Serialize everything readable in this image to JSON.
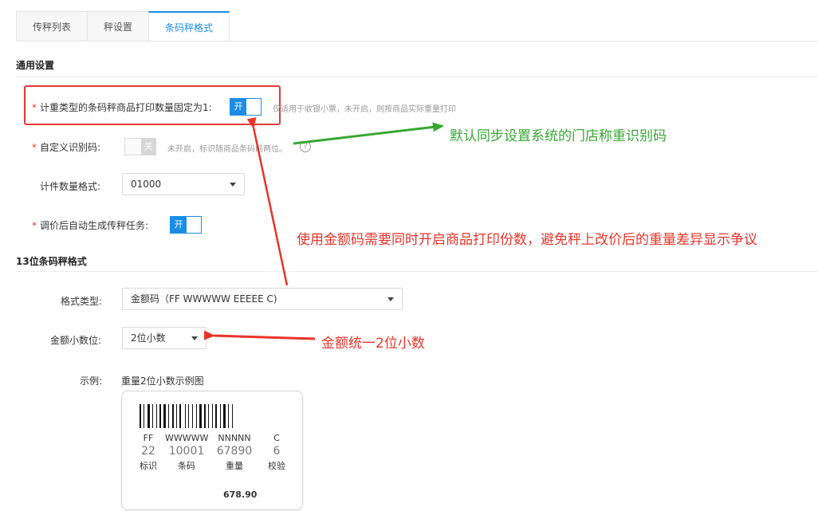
{
  "tabs": [
    {
      "label": "传秤列表"
    },
    {
      "label": "秤设置"
    },
    {
      "label": "条码秤格式",
      "active": true
    }
  ],
  "general": {
    "title": "通用设置",
    "fixed_qty": {
      "label": "计重类型的条码秤商品打印数量固定为1:",
      "switch": "开",
      "hint": "仅适用于收银小票，未开启，则按商品实际重量打印"
    },
    "custom_code": {
      "label": "自定义识别码:",
      "switch": "关",
      "hint": "未开启，标识随商品条码前两位。",
      "help": "?"
    },
    "piece_format": {
      "label": "计件数量格式:",
      "value": "01000"
    },
    "auto_task": {
      "label": "调价后自动生成传秤任务:",
      "switch": "开"
    }
  },
  "format13": {
    "title": "13位条码秤格式",
    "format_type": {
      "label": "格式类型:",
      "value": "金额码（FF WWWWW EEEEE C)"
    },
    "amount_decimals": {
      "label": "金额小数位:",
      "value": "2位小数"
    },
    "example": {
      "label": "示例:",
      "caption": "重量2位小数示例图",
      "codes": [
        "FF",
        "WWWWW",
        "NNNNN",
        "C"
      ],
      "values": [
        "22",
        "10001",
        "67890",
        "6"
      ],
      "names": [
        "标识",
        "条码",
        "重量",
        "校验"
      ],
      "total": "678.90"
    }
  },
  "annotations": {
    "green": "默认同步设置系统的门店称重识别码",
    "red_main": "使用金额码需要同时开启商品打印份数，避免秤上改价后的重量差异显示争议",
    "red_decimal": "金额统一2位小数"
  },
  "colors": {
    "accent": "#1a8ee6",
    "green": "#36a733",
    "red": "#e8342a"
  }
}
